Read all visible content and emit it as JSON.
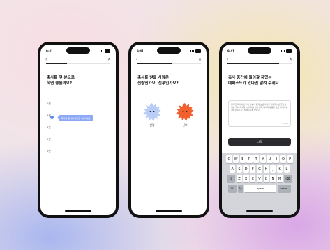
{
  "status_time": "9:41",
  "screen1": {
    "title": "축사를 몇 분으로\n하면 좋을까요?",
    "options": [
      "2분",
      "3분",
      "4분",
      "5분",
      "6분"
    ],
    "tooltip": "축사를 듣기에 적당한 시간이에요"
  },
  "screen2": {
    "title": "축사를 받을 사람은\n신랑인가요, 신부인가요?",
    "groom_label": "신랑",
    "bride_label": "신부"
  },
  "screen3": {
    "title": "축사 중간에 들어갈 재밌는\n에피소드가 있다면 알려 주세요.",
    "textarea_text": "친해진 계기와 신부와 신랑이 함께 보낸 추억을 알려주시면 좋아요. 예를 들어 대학교 시절 처음 만나 함께 동아리 활동을 했던 이야기를 적어주세요. 더 자세할수록 좋아요.",
    "counter": "0/300",
    "next_button": "다음",
    "keyboard": {
      "row1": [
        "Q",
        "W",
        "E",
        "R",
        "T",
        "Y",
        "U",
        "I",
        "O",
        "P"
      ],
      "row2": [
        "A",
        "S",
        "D",
        "F",
        "G",
        "H",
        "J",
        "K",
        "L"
      ],
      "row3": [
        "Z",
        "X",
        "C",
        "V",
        "B",
        "N",
        "M"
      ],
      "numbers_key": "123",
      "space_label": "space",
      "return_label": "return"
    }
  }
}
